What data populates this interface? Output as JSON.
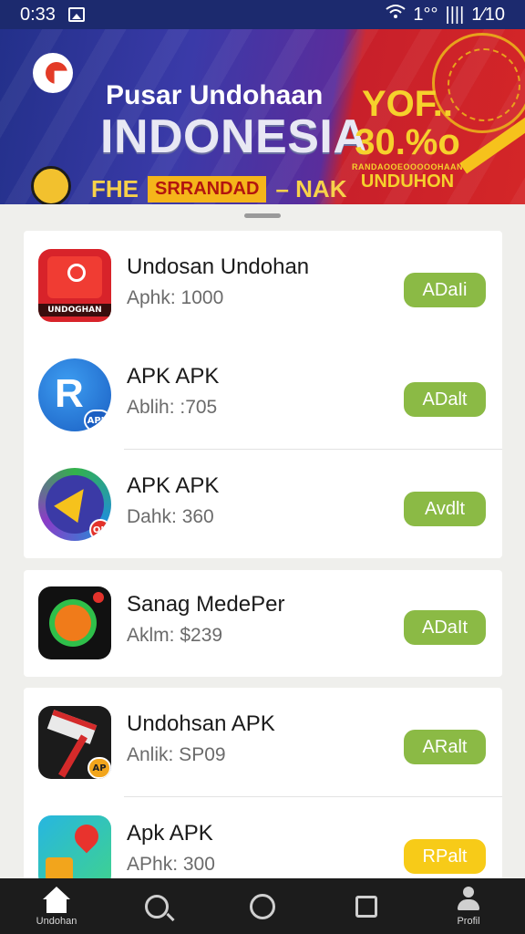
{
  "status_bar": {
    "time": "0:33",
    "right_text": "1°°",
    "battery": "1⁄10",
    "signal": "||||"
  },
  "banner": {
    "title_top": "Pusar Undohaan",
    "title_big": "INDONESIA",
    "tag_left": "FHE",
    "tag_pill": "SRRANDAD",
    "tag_right": "– NAK",
    "promo_line1": "YOF..",
    "promo_line2": "30.%o",
    "promo_small": "RANDAOOEOOOOOHAAN",
    "promo_line3": "UNDUHON"
  },
  "apps": [
    {
      "name": "Undosan Undohan",
      "meta": "Aphk: 1000",
      "button": "ADaIi",
      "icon": "red-app-icon",
      "badge": "UNDOGHAN"
    },
    {
      "name": "APK APK",
      "meta": "Ablih: :705",
      "button": "ADalt",
      "icon": "blue-r-app-icon",
      "badge": "APK"
    },
    {
      "name": "APK APK",
      "meta": "Dahk: 360",
      "button": "Avdlt",
      "icon": "ring-arrow-app-icon",
      "badge": "OK"
    },
    {
      "name": "Sanag MedePer",
      "meta": "Aklm: $239",
      "button": "ADaIt",
      "icon": "sun-app-icon",
      "badge": ""
    },
    {
      "name": "Undohsan APK",
      "meta": "Anlik: SP09",
      "button": "ARalt",
      "icon": "tool-app-icon",
      "badge": "AP"
    },
    {
      "name": "Apk APK",
      "meta": "APhk: 300",
      "button": "RPalt",
      "icon": "map-app-icon",
      "badge": ""
    }
  ],
  "bottom_nav": {
    "home_label": "Undohan",
    "profile_label": "Profil"
  },
  "colors": {
    "accent_green": "#8bba45",
    "accent_yellow": "#f7cb18",
    "banner_blue": "#23308a",
    "banner_red": "#d42628"
  }
}
